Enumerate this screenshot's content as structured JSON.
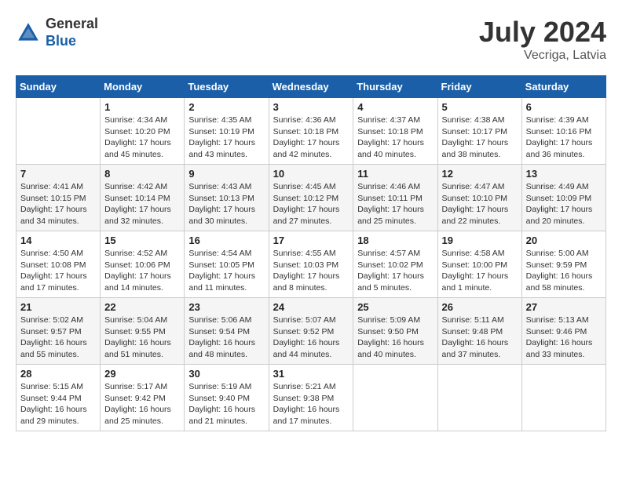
{
  "header": {
    "logo_general": "General",
    "logo_blue": "Blue",
    "title": "July 2024",
    "location": "Vecriga, Latvia"
  },
  "days_of_week": [
    "Sunday",
    "Monday",
    "Tuesday",
    "Wednesday",
    "Thursday",
    "Friday",
    "Saturday"
  ],
  "weeks": [
    [
      {
        "day": "",
        "info": ""
      },
      {
        "day": "1",
        "info": "Sunrise: 4:34 AM\nSunset: 10:20 PM\nDaylight: 17 hours\nand 45 minutes."
      },
      {
        "day": "2",
        "info": "Sunrise: 4:35 AM\nSunset: 10:19 PM\nDaylight: 17 hours\nand 43 minutes."
      },
      {
        "day": "3",
        "info": "Sunrise: 4:36 AM\nSunset: 10:18 PM\nDaylight: 17 hours\nand 42 minutes."
      },
      {
        "day": "4",
        "info": "Sunrise: 4:37 AM\nSunset: 10:18 PM\nDaylight: 17 hours\nand 40 minutes."
      },
      {
        "day": "5",
        "info": "Sunrise: 4:38 AM\nSunset: 10:17 PM\nDaylight: 17 hours\nand 38 minutes."
      },
      {
        "day": "6",
        "info": "Sunrise: 4:39 AM\nSunset: 10:16 PM\nDaylight: 17 hours\nand 36 minutes."
      }
    ],
    [
      {
        "day": "7",
        "info": "Sunrise: 4:41 AM\nSunset: 10:15 PM\nDaylight: 17 hours\nand 34 minutes."
      },
      {
        "day": "8",
        "info": "Sunrise: 4:42 AM\nSunset: 10:14 PM\nDaylight: 17 hours\nand 32 minutes."
      },
      {
        "day": "9",
        "info": "Sunrise: 4:43 AM\nSunset: 10:13 PM\nDaylight: 17 hours\nand 30 minutes."
      },
      {
        "day": "10",
        "info": "Sunrise: 4:45 AM\nSunset: 10:12 PM\nDaylight: 17 hours\nand 27 minutes."
      },
      {
        "day": "11",
        "info": "Sunrise: 4:46 AM\nSunset: 10:11 PM\nDaylight: 17 hours\nand 25 minutes."
      },
      {
        "day": "12",
        "info": "Sunrise: 4:47 AM\nSunset: 10:10 PM\nDaylight: 17 hours\nand 22 minutes."
      },
      {
        "day": "13",
        "info": "Sunrise: 4:49 AM\nSunset: 10:09 PM\nDaylight: 17 hours\nand 20 minutes."
      }
    ],
    [
      {
        "day": "14",
        "info": "Sunrise: 4:50 AM\nSunset: 10:08 PM\nDaylight: 17 hours\nand 17 minutes."
      },
      {
        "day": "15",
        "info": "Sunrise: 4:52 AM\nSunset: 10:06 PM\nDaylight: 17 hours\nand 14 minutes."
      },
      {
        "day": "16",
        "info": "Sunrise: 4:54 AM\nSunset: 10:05 PM\nDaylight: 17 hours\nand 11 minutes."
      },
      {
        "day": "17",
        "info": "Sunrise: 4:55 AM\nSunset: 10:03 PM\nDaylight: 17 hours\nand 8 minutes."
      },
      {
        "day": "18",
        "info": "Sunrise: 4:57 AM\nSunset: 10:02 PM\nDaylight: 17 hours\nand 5 minutes."
      },
      {
        "day": "19",
        "info": "Sunrise: 4:58 AM\nSunset: 10:00 PM\nDaylight: 17 hours\nand 1 minute."
      },
      {
        "day": "20",
        "info": "Sunrise: 5:00 AM\nSunset: 9:59 PM\nDaylight: 16 hours\nand 58 minutes."
      }
    ],
    [
      {
        "day": "21",
        "info": "Sunrise: 5:02 AM\nSunset: 9:57 PM\nDaylight: 16 hours\nand 55 minutes."
      },
      {
        "day": "22",
        "info": "Sunrise: 5:04 AM\nSunset: 9:55 PM\nDaylight: 16 hours\nand 51 minutes."
      },
      {
        "day": "23",
        "info": "Sunrise: 5:06 AM\nSunset: 9:54 PM\nDaylight: 16 hours\nand 48 minutes."
      },
      {
        "day": "24",
        "info": "Sunrise: 5:07 AM\nSunset: 9:52 PM\nDaylight: 16 hours\nand 44 minutes."
      },
      {
        "day": "25",
        "info": "Sunrise: 5:09 AM\nSunset: 9:50 PM\nDaylight: 16 hours\nand 40 minutes."
      },
      {
        "day": "26",
        "info": "Sunrise: 5:11 AM\nSunset: 9:48 PM\nDaylight: 16 hours\nand 37 minutes."
      },
      {
        "day": "27",
        "info": "Sunrise: 5:13 AM\nSunset: 9:46 PM\nDaylight: 16 hours\nand 33 minutes."
      }
    ],
    [
      {
        "day": "28",
        "info": "Sunrise: 5:15 AM\nSunset: 9:44 PM\nDaylight: 16 hours\nand 29 minutes."
      },
      {
        "day": "29",
        "info": "Sunrise: 5:17 AM\nSunset: 9:42 PM\nDaylight: 16 hours\nand 25 minutes."
      },
      {
        "day": "30",
        "info": "Sunrise: 5:19 AM\nSunset: 9:40 PM\nDaylight: 16 hours\nand 21 minutes."
      },
      {
        "day": "31",
        "info": "Sunrise: 5:21 AM\nSunset: 9:38 PM\nDaylight: 16 hours\nand 17 minutes."
      },
      {
        "day": "",
        "info": ""
      },
      {
        "day": "",
        "info": ""
      },
      {
        "day": "",
        "info": ""
      }
    ]
  ]
}
